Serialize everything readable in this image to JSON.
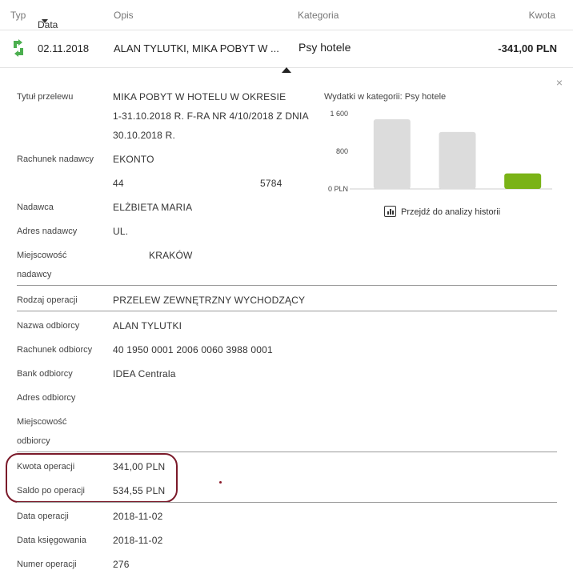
{
  "header": {
    "type": "Typ",
    "date": "Data",
    "description": "Opis",
    "category": "Kategoria",
    "amount": "Kwota"
  },
  "transaction": {
    "date": "02.11.2018",
    "description": "ALAN TYLUTKI, MIKA POBYT W ...",
    "category": "Psy hotele",
    "amount": "-341,00 PLN"
  },
  "details": {
    "title_label": "Tytuł przelewu",
    "title_lines": [
      "MIKA POBYT W HOTELU W OKRESIE",
      "1-31.10.2018 R. F-RA NR 4/10/2018 Z DNIA",
      "30.10.2018 R."
    ],
    "sender_account_label": "Rachunek nadawcy",
    "sender_account_name": "EKONTO",
    "sender_account_start": "44",
    "sender_account_end": "5784",
    "sender_label": "Nadawca",
    "sender_value": "ELŻBIETA MARIA",
    "sender_address_label": "Adres nadawcy",
    "sender_address_value": "UL.",
    "sender_city_label_1": "Miejscowość",
    "sender_city_label_2": "nadawcy",
    "sender_city_value": "KRAKÓW",
    "op_type_label": "Rodzaj operacji",
    "op_type_value": "PRZELEW ZEWNĘTRZNY WYCHODZĄCY",
    "recipient_label": "Nazwa odbiorcy",
    "recipient_value": "ALAN TYLUTKI",
    "recipient_account_label": "Rachunek odbiorcy",
    "recipient_account_value": "40 1950 0001 2006 0060 3988 0001",
    "bank_label": "Bank odbiorcy",
    "bank_value": "IDEA Centrala",
    "recipient_address_label": "Adres odbiorcy",
    "recipient_city_label_1": "Miejscowość",
    "recipient_city_label_2": "odbiorcy",
    "op_amount_label": "Kwota operacji",
    "op_amount_value": "341,00 PLN",
    "balance_label": "Saldo po operacji",
    "balance_value": "534,55 PLN",
    "op_date_label": "Data operacji",
    "op_date_value": "2018-11-02",
    "booking_date_label": "Data księgowania",
    "booking_date_value": "2018-11-02",
    "op_number_label": "Numer operacji",
    "op_number_value": "276"
  },
  "chart_title": "Wydatki w kategorii: Psy hotele",
  "chart_data": {
    "type": "bar",
    "title": "Wydatki w kategorii: Psy hotele",
    "categories": [
      "",
      "",
      ""
    ],
    "values": [
      1480,
      1210,
      330
    ],
    "highlight_index": 2,
    "ylim": [
      0,
      1600
    ],
    "yticks": [
      0,
      800,
      1600
    ],
    "ytick_labels": [
      "0 PLN",
      "800",
      "1 600"
    ],
    "bar_color": "#dcdcdc",
    "highlight_color": "#7ab317"
  },
  "analysis_link": "Przejdź do analizy historii",
  "colors": {
    "accent_green": "#4caf50",
    "highlight_border": "#7b1a2a"
  },
  "icons": {
    "transfer": "transfer-arrows-icon",
    "close": "close-icon",
    "chart": "bar-chart-icon"
  },
  "close_glyph": "×"
}
